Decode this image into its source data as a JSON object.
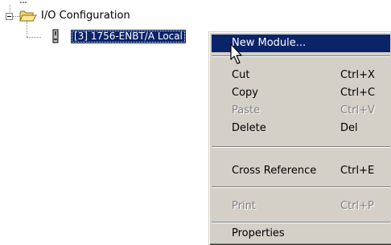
{
  "tree": {
    "parent_dots": "...",
    "io_configuration_label": "I/O Configuration",
    "module_label": "[3] 1756-ENBT/A Local"
  },
  "context_menu": {
    "items": [
      {
        "label": "New Module...",
        "shortcut": "",
        "state": "highlighted"
      },
      {
        "label": "Cut",
        "shortcut": "Ctrl+X",
        "state": "enabled"
      },
      {
        "label": "Copy",
        "shortcut": "Ctrl+C",
        "state": "enabled"
      },
      {
        "label": "Paste",
        "shortcut": "Ctrl+V",
        "state": "disabled"
      },
      {
        "label": "Delete",
        "shortcut": "Del",
        "state": "enabled"
      },
      {
        "label": "Cross Reference",
        "shortcut": "Ctrl+E",
        "state": "enabled"
      },
      {
        "label": "Print",
        "shortcut": "Ctrl+P",
        "state": "disabled"
      },
      {
        "label": "Properties",
        "shortcut": "",
        "state": "enabled"
      }
    ]
  },
  "colors": {
    "selection": "#0a246a",
    "menu_face": "#d4d0c8",
    "folder": "#f7d56a"
  },
  "icons": [
    "collapse-icon",
    "folder-icon",
    "module-icon",
    "mouse-pointer-icon"
  ]
}
